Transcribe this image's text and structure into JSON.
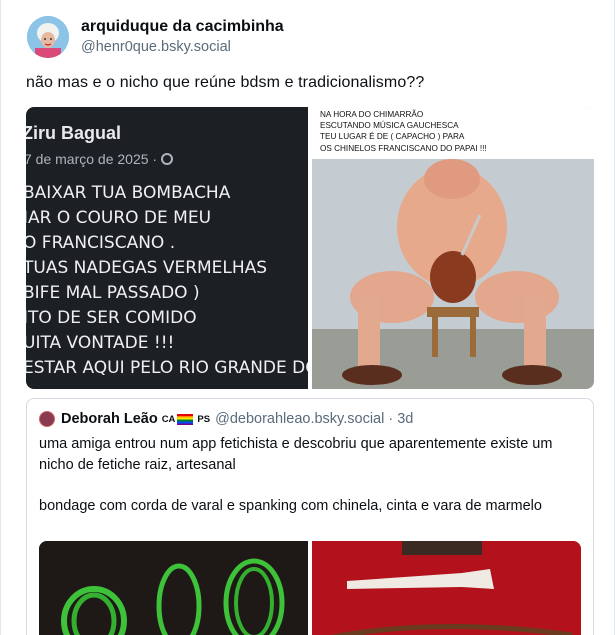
{
  "post": {
    "display_name": "arquiduque da cacimbinha",
    "handle": "@henr0que.bsky.social",
    "text": "não mas e o nicho que reúne bdsm e tradicionalismo??"
  },
  "image_left": {
    "name": "Ziru Bagual",
    "date": "7 de março de 2025 · ",
    "globe_icon": "globe-icon",
    "lines": [
      "BAIXAR TUA BOMBACHA",
      "IAR O COURO DE MEU",
      "O FRANCISCANO .",
      "TUAS NADEGAS VERMELHAS",
      "BIFE MAL PASSADO )",
      "ITO DE SER COMIDO",
      "UITA VONTADE !!!",
      "ESTAR AQUI PELO RIO GRANDE DO"
    ]
  },
  "image_right": {
    "caption": [
      "NA HORA DO CHIMARRÃO",
      "ESCUTANDO MÚSICA GAUCHESCA",
      "TEU LUGAR É DE ( CAPACHO ) PARA",
      "OS CHINELOS FRANCISCANO DO PAPAI !!!"
    ]
  },
  "quote": {
    "name": "Deborah Leão",
    "tag_a": "CA",
    "tag_b": "PS",
    "handle": "@deborahleao.bsky.social · 3d",
    "paragraph_1": "uma amiga entrou num app fetichista e descobriu que aparentemente existe um nicho de fetiche raiz, artesanal",
    "paragraph_2": "bondage com corda de varal e spanking com chinela, cinta e vara de marmelo"
  },
  "colors": {
    "text": "#0b0f14",
    "muted": "#5a6b7b",
    "border": "#d4dbe2"
  }
}
